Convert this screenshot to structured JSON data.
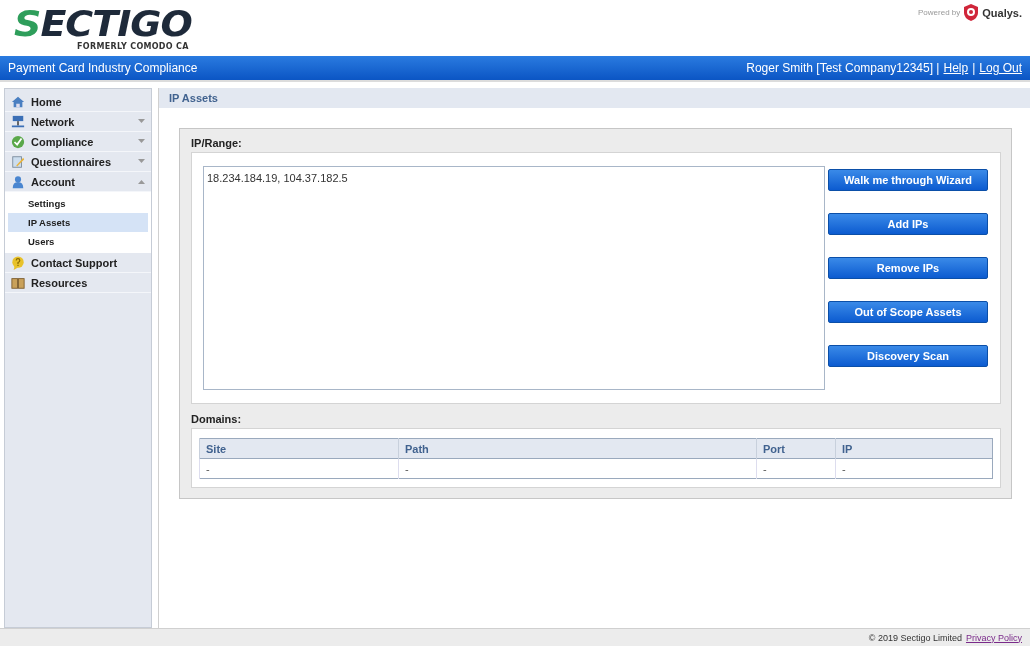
{
  "header": {
    "logo": "SECTIGO",
    "logo_subtitle": "FORMERLY COMODO CA",
    "powered_by": "Powered by",
    "partner": "Qualys."
  },
  "title_bar": {
    "title": "Payment Card Industry Compliance",
    "user": "Roger Smith [Test Company12345] |",
    "links": [
      "Help",
      "Log Out"
    ],
    "separator": "|"
  },
  "sidebar": {
    "items": [
      {
        "label": "Home",
        "selected": false
      },
      {
        "label": "Network",
        "selected": false,
        "expanded": false
      },
      {
        "label": "Compliance",
        "selected": false,
        "expanded": false
      },
      {
        "label": "Questionnaires",
        "selected": false,
        "expanded": false
      },
      {
        "label": "Account",
        "selected": false,
        "expanded": true,
        "children": [
          {
            "label": "Settings",
            "selected": false
          },
          {
            "label": "IP Assets",
            "selected": true
          },
          {
            "label": "Users",
            "selected": false
          }
        ]
      },
      {
        "label": "Contact Support",
        "selected": false
      },
      {
        "label": "Resources",
        "selected": false
      }
    ]
  },
  "main": {
    "title": "IP Assets",
    "ip_range_label": "IP/Range:",
    "ip_range_value": "18.234.184.19, 104.37.182.5",
    "buttons": [
      "Walk me through Wizard",
      "Add IPs",
      "Remove IPs",
      "Out of Scope Assets",
      "Discovery Scan"
    ],
    "domains_label": "Domains:",
    "domains_table": {
      "columns": [
        "Site",
        "Path",
        "Port",
        "IP"
      ],
      "rows": [
        [
          "-",
          "-",
          "-",
          "-"
        ]
      ]
    }
  },
  "footer": {
    "copyright": "© 2019 Sectigo Limited",
    "link": "Privacy Policy"
  }
}
